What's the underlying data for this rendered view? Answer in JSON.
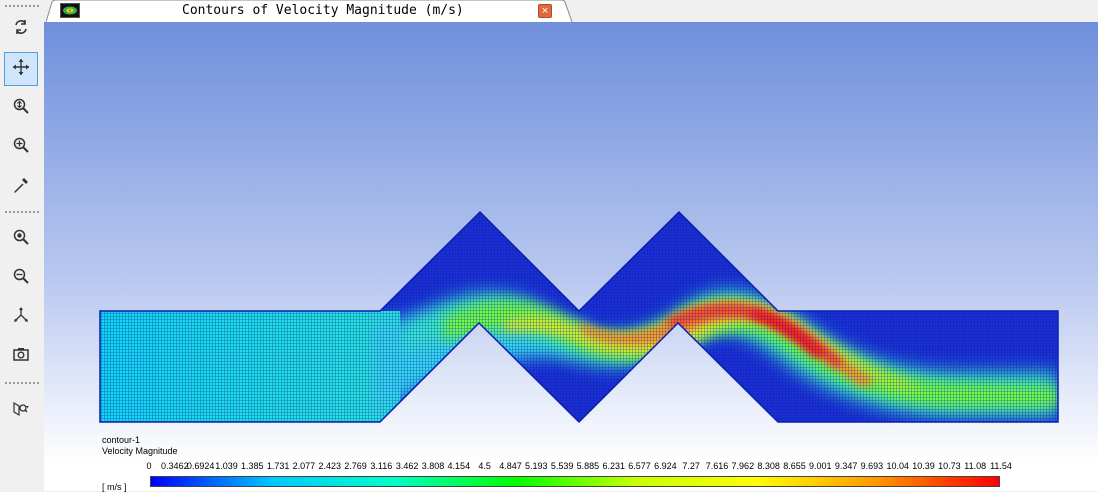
{
  "window": {
    "tab_title": "Contours of Velocity Magnitude (m/s)",
    "tab_icon": "fluent-graphics-icon",
    "close_label": "×"
  },
  "toolbar": {
    "items": [
      {
        "icon": "rotate-icon"
      },
      {
        "icon": "pan-icon",
        "active": true
      },
      {
        "icon": "zoom-icon"
      },
      {
        "icon": "zoom-in-icon"
      },
      {
        "icon": "probe-icon"
      },
      {
        "icon": "fit-to-window-icon"
      },
      {
        "icon": "zoom-out-icon"
      },
      {
        "icon": "orient-axes-icon"
      },
      {
        "icon": "camera-icon"
      },
      {
        "icon": "view-options-icon"
      }
    ]
  },
  "legend": {
    "name": "contour-1",
    "variable": "Velocity Magnitude",
    "unit": "[ m/s ]",
    "ticks": [
      "0",
      "0.3462",
      "0.6924",
      "1.039",
      "1.385",
      "1.731",
      "2.077",
      "2.423",
      "2.769",
      "3.116",
      "3.462",
      "3.808",
      "4.154",
      "4.5",
      "4.847",
      "5.193",
      "5.539",
      "5.885",
      "6.231",
      "6.577",
      "6.924",
      "7.27",
      "7.616",
      "7.962",
      "8.308",
      "8.655",
      "9.001",
      "9.347",
      "9.693",
      "10.04",
      "10.39",
      "10.73",
      "11.08",
      "11.54"
    ],
    "colors": [
      "#0000ff",
      "#00c8ff",
      "#00ffc8",
      "#00ff00",
      "#c8ff00",
      "#ffff00",
      "#ff9600",
      "#ff0000"
    ]
  }
}
